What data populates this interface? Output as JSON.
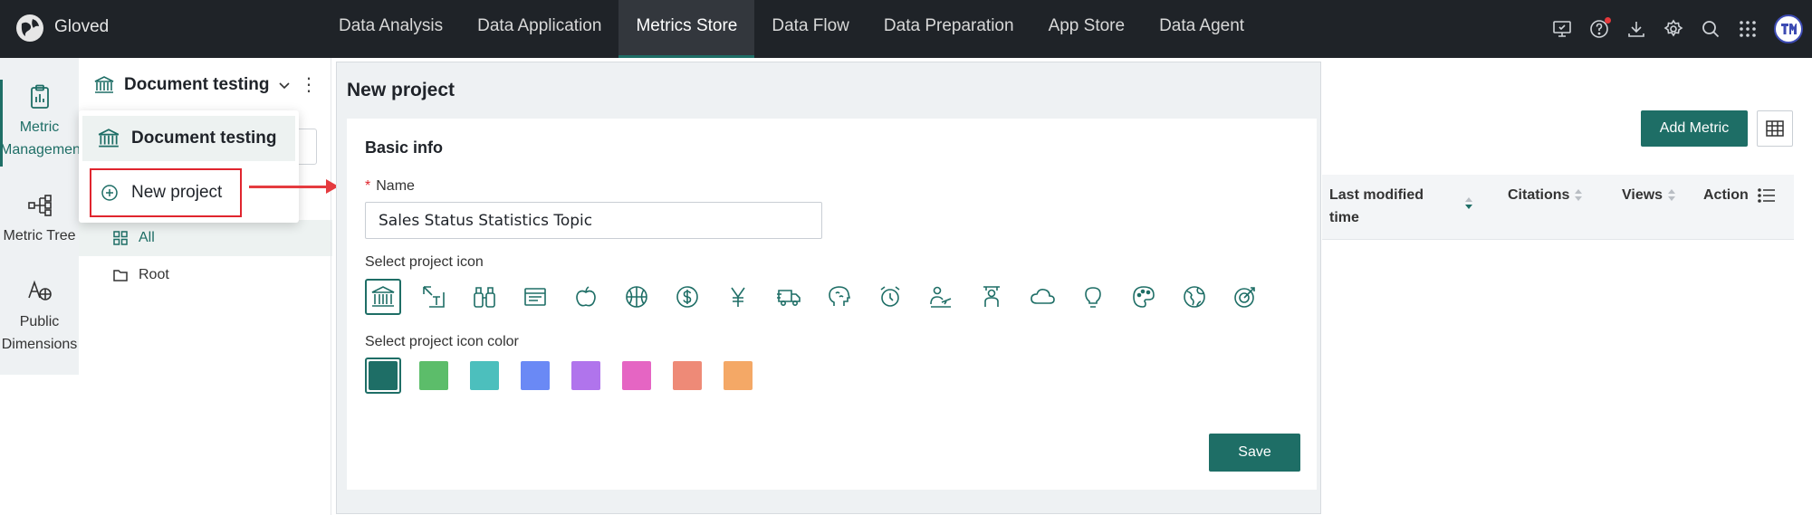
{
  "app": {
    "brand": "Gloved"
  },
  "nav": {
    "items": [
      {
        "label": "Data Analysis"
      },
      {
        "label": "Data Application"
      },
      {
        "label": "Metrics Store"
      },
      {
        "label": "Data Flow"
      },
      {
        "label": "Data Preparation"
      },
      {
        "label": "App Store"
      },
      {
        "label": "Data Agent"
      }
    ],
    "active": "Metrics Store"
  },
  "top_icons": [
    "monitor-icon",
    "help-icon",
    "download-icon",
    "settings-icon",
    "search-icon",
    "apps-grid-icon",
    "user-avatar"
  ],
  "rail": {
    "items": [
      {
        "label_line1": "Metric",
        "label_line2": "Managemen",
        "icon": "clipboard-icon",
        "active": true
      },
      {
        "label_line1": "Metric Tree",
        "icon": "tree-icon",
        "active": false
      },
      {
        "label_line1": "Public",
        "label_line2": "Dimensions",
        "icon": "dimension-icon",
        "active": false
      }
    ]
  },
  "project": {
    "current": "Document testing",
    "dropdown": {
      "item_current": "Document testing",
      "item_new": "New project"
    }
  },
  "folders": [
    {
      "label": "All",
      "icon": "grid-icon",
      "selected": true
    },
    {
      "label": "Root",
      "icon": "folder-icon",
      "selected": false
    }
  ],
  "modal": {
    "title": "New project",
    "section_title": "Basic info",
    "name_label": "Name",
    "name_required_mark": "*",
    "name_value": "Sales Status Statistics Topic",
    "icon_label": "Select project icon",
    "icons": [
      "bank-icon",
      "text-resize-icon",
      "binoculars-icon",
      "news-icon",
      "apple-icon",
      "basketball-icon",
      "dollar-icon",
      "yen-icon",
      "truck-icon",
      "brain-icon",
      "alarm-clock-icon",
      "person-plane-icon",
      "teacher-icon",
      "cloud-icon",
      "lightbulb-icon",
      "palette-icon",
      "globe-icon",
      "target-icon"
    ],
    "selected_icon": 0,
    "color_label": "Select project icon color",
    "colors": [
      "#1e6e66",
      "#5cbd6a",
      "#4cbfbd",
      "#6a89f5",
      "#b074ec",
      "#e565c3",
      "#ee8a77",
      "#f4a866"
    ],
    "selected_color": 0,
    "save_label": "Save"
  },
  "table": {
    "add_label": "Add Metric",
    "columns": [
      {
        "label_line1": "Last modified",
        "label_line2": "time"
      },
      {
        "label_line1": "Citations"
      },
      {
        "label_line1": "Views"
      },
      {
        "label_line1": "Action"
      }
    ]
  }
}
